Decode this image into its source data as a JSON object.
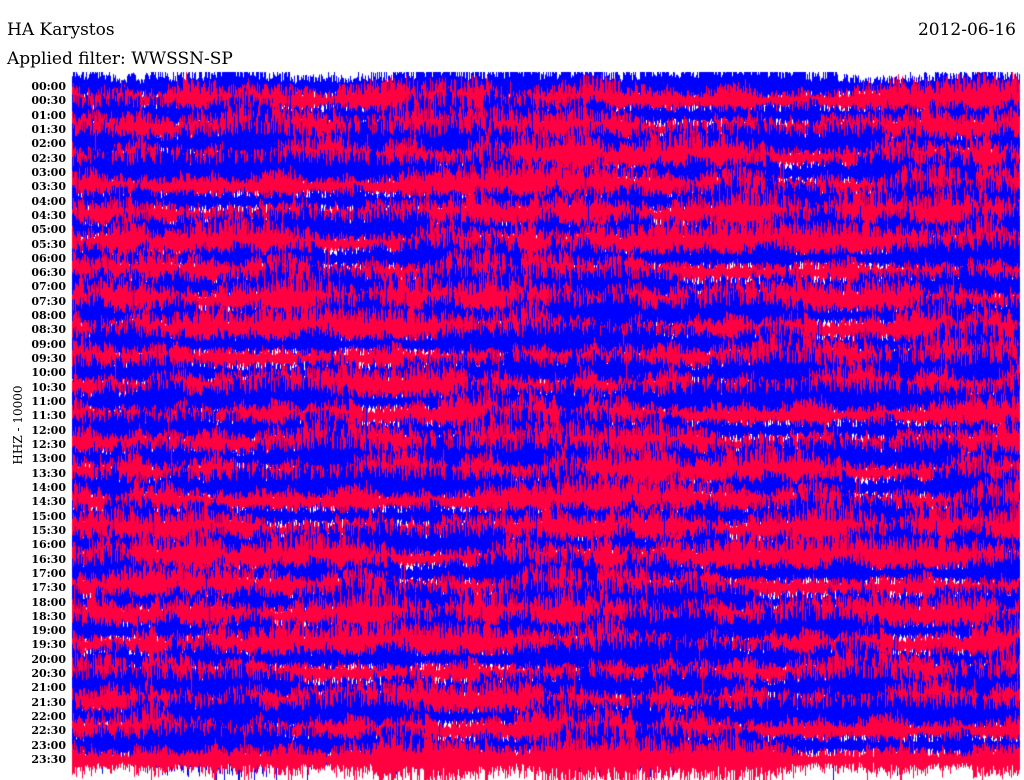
{
  "header": {
    "station": "HA Karystos",
    "filter": "Applied filter: WWSSN-SP",
    "date": "2012-06-16"
  },
  "axis": {
    "channel": "HHZ - 10000",
    "ticks": [
      "00:00",
      "00:30",
      "01:00",
      "01:30",
      "02:00",
      "02:30",
      "03:00",
      "03:30",
      "04:00",
      "04:30",
      "05:00",
      "05:30",
      "06:00",
      "06:30",
      "07:00",
      "07:30",
      "08:00",
      "08:30",
      "09:00",
      "09:30",
      "10:00",
      "10:30",
      "11:00",
      "11:30",
      "12:00",
      "12:30",
      "13:00",
      "13:30",
      "14:00",
      "14:30",
      "15:00",
      "15:30",
      "16:00",
      "16:30",
      "17:00",
      "17:30",
      "18:00",
      "18:30",
      "19:00",
      "19:30",
      "20:00",
      "20:30",
      "21:00",
      "21:30",
      "22:00",
      "22:30",
      "23:00",
      "23:30"
    ]
  },
  "colors": {
    "trace_a": "#0000ff",
    "trace_b": "#ff0040"
  }
}
